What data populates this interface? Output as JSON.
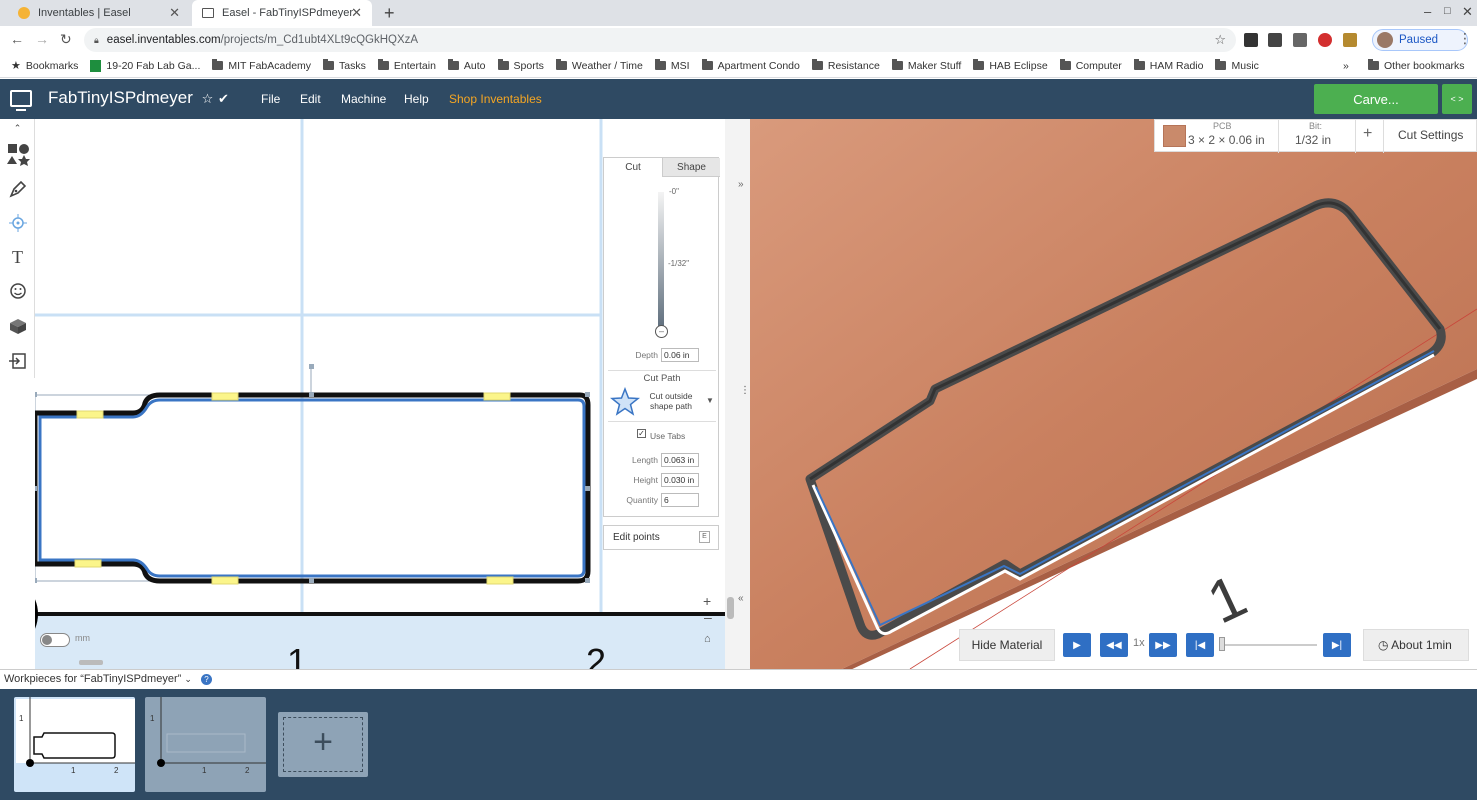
{
  "browser": {
    "tabs": [
      {
        "title": "Inventables | Easel",
        "active": false
      },
      {
        "title": "Easel - FabTinyISPdmeyer",
        "active": true
      }
    ],
    "url_host": "easel.inventables.com",
    "url_path": "/projects/m_Cd1ubt4XLt9cQGkHQXzA",
    "profile_status": "Paused",
    "bookmarks": [
      "Bookmarks",
      "19-20 Fab Lab Ga...",
      "MIT FabAcademy",
      "Tasks",
      "Entertain",
      "Auto",
      "Sports",
      "Weather / Time",
      "MSI",
      "Apartment Condo",
      "Resistance",
      "Maker Stuff",
      "HAB Eclipse",
      "Computer",
      "HAM Radio",
      "Music"
    ],
    "bookmarks_overflow": "»",
    "other_bookmarks": "Other bookmarks"
  },
  "app": {
    "project_title": "FabTinyISPdmeyer",
    "menu": [
      "File",
      "Edit",
      "Machine",
      "Help"
    ],
    "shop_link": "Shop Inventables",
    "carve_label": "Carve...",
    "brand_color": "#2f4a63",
    "carve_color": "#4caf50",
    "shop_color": "#f5a623"
  },
  "canvas": {
    "unit_inch": "inch",
    "unit_mm": "mm",
    "ruler_labels": [
      "1",
      "2"
    ]
  },
  "cut_panel": {
    "tabs": [
      "Cut",
      "Shape"
    ],
    "depth_top": "-0\"",
    "depth_mid_prefix": "-",
    "depth_mid_frac": "1/32",
    "depth_mid_suffix": "\"",
    "depth_label": "Depth",
    "depth_value": "0.06 in",
    "cut_path_title": "Cut Path",
    "cut_path_value": "Cut outside shape path",
    "use_tabs_label": "Use Tabs",
    "use_tabs_checked": true,
    "length_label": "Length",
    "length_value": "0.063 in",
    "height_label": "Height",
    "height_value": "0.030 in",
    "quantity_label": "Quantity",
    "quantity_value": "6",
    "edit_points_label": "Edit points",
    "edit_points_key": "E"
  },
  "preview": {
    "material_label": "PCB",
    "material_dims": "3 × 2 × 0.06 in",
    "bit_label": "Bit:",
    "bit_value": "1/32 in",
    "add_label": "+",
    "cut_settings": "Cut Settings",
    "hide_material": "Hide Material",
    "speed": "1x",
    "time_estimate": "About 1min",
    "workpiece_number": "1"
  },
  "workpieces": {
    "header": "Workpieces for “FabTinyISPdmeyer”",
    "thumb_labels_y": "1",
    "thumb_labels_x": [
      "1",
      "2"
    ]
  }
}
